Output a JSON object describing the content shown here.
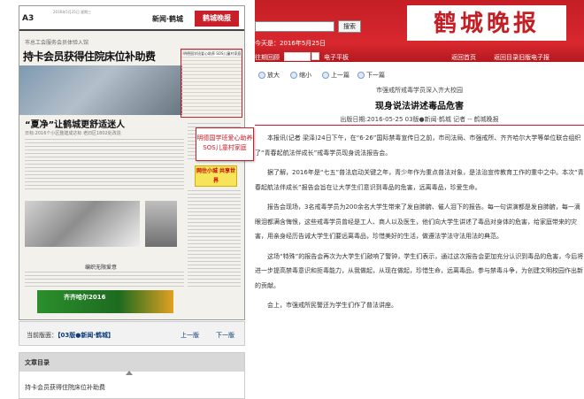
{
  "paper": {
    "page_num": "A3",
    "page_date": "2016年5月25日 星期三",
    "section": "新闻·鹤城",
    "logo": "鹤城晚报",
    "kicker": "市总工会服务会员体验入馆",
    "headline": "持卡会员获得住院床位补助费",
    "headline2": "“夏净”让鹤城更舒适迷人",
    "sub2": "日标:2016个小区整建成达标 老旧区1802处改造",
    "redbox_title": "明德国学班爱心助养 SOS儿童村家庭",
    "ad_text": "网住小城 共享世界",
    "caption": "编织无限爱意",
    "banner_text": "齐齐哈尔2016"
  },
  "popup": {
    "text": "明德国学班爱心助养SOS儿童村家庭"
  },
  "pager": {
    "current_label": "当前版面：",
    "current_value": "【03版●新闻·鹤城】",
    "prev_page": "上一版",
    "next_page": "下一版"
  },
  "toc": {
    "title": "文章目录",
    "items": [
      "持卡会员获得住院床位补助费"
    ]
  },
  "header": {
    "search_placeholder": "",
    "search_button": "搜索",
    "brand": "鹤城晚报",
    "today": "今天是：2016年5月25日",
    "date_label": "往期回顾",
    "date_value": "",
    "electronic": "电子平板",
    "home": "返回首页",
    "back_e": "返回目录旧版电子报"
  },
  "toolbar": {
    "zoom_in": "放大",
    "zoom_out": "缩小",
    "prev": "上一篇",
    "next": "下一篇"
  },
  "article": {
    "kicker": "市强戒所戒毒学员深入齐大校园",
    "title": "现身说法讲述毒品危害",
    "meta": "出版日期:2016-05-25    03版●新闻·鹤城    记者 --    鹤城晚报",
    "paragraphs": [
      "本报讯(记者 梁泽)24日下午，在“6·26”国际禁毒宣传日之前，市司法局、市强戒所、齐齐哈尔大学等单位联合组织了“青春起航法伴成长”戒毒学员现身说法报告会。",
      "据了解，2016年是“七五”普法启动关键之年，青少年作为重点普法对象，是法治宣传教育工作的重中之中。本次“青春起航法伴成长”报告会旨在让大学生们意识到毒品的危害，远离毒品，珍爱生命。",
      "报告会现场，3名戒毒学员为200余名大学生带来了发自肺腑、催人泪下的报告。每一句讲演都是发自肺腑，每一滴眼泪都满含悔恨，这些戒毒学员曾经是工人、商人以及医生，他们向大学生讲述了毒品对身体的危害，给家庭带来的灾害，用亲身经历告诫大学生们要远离毒品，珍惜美好的生活，做遵法学法守法用法的典范。",
      "这场“特殊”的报告会再次为大学生们敲响了警钟，学生们表示，通过这次报告会更加充分认识到毒品的危害，今后将进一步提高禁毒意识和拒毒能力，从我做起，从现在做起，珍惜生命，远离毒品，参与禁毒斗争，为创建文明校园作出新的贡献。",
      "会上，市强戒所民警还为学生们作了普法讲座。"
    ]
  }
}
